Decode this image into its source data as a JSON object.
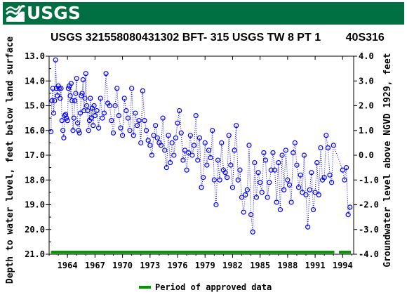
{
  "header": {
    "agency": "USGS"
  },
  "colors": {
    "banner": "#006f41",
    "series": "#0000ff",
    "approved": "#009900"
  },
  "chart_data": {
    "type": "scatter",
    "title": "USGS 321558080431302 BFT- 315 USGS TW 8 PT 1        40S316",
    "ylabel": "Depth to water level, feet below land surface",
    "y2label": "Groundwater level above NGVD 1929, feet",
    "x_ticks": [
      "1964",
      "1967",
      "1970",
      "1973",
      "1976",
      "1979",
      "1982",
      "1985",
      "1988",
      "1991",
      "1994"
    ],
    "y_ticks": [
      "13.0",
      "14.0",
      "15.0",
      "16.0",
      "17.0",
      "18.0",
      "19.0",
      "20.0",
      "21.0"
    ],
    "y2_ticks": [
      "4.0",
      "3.0",
      "2.0",
      "1.0",
      "0.0",
      "-1.0",
      "-2.0",
      "-3.0",
      "-4.0"
    ],
    "xlim": [
      1962.0,
      1995.2
    ],
    "ylim": [
      21.0,
      13.0
    ],
    "y2lim": [
      -4.0,
      4.0
    ],
    "y_inverted": true,
    "series": [
      {
        "style": "dotted line with open circle markers",
        "x": [
          1962.2,
          1962.3,
          1962.4,
          1962.5,
          1962.6,
          1962.7,
          1962.8,
          1962.9,
          1963.0,
          1963.1,
          1963.2,
          1963.3,
          1963.4,
          1963.5,
          1963.6,
          1963.7,
          1963.8,
          1963.9,
          1964.0,
          1964.1,
          1964.2,
          1964.3,
          1964.4,
          1964.5,
          1964.6,
          1964.7,
          1964.8,
          1964.9,
          1965.0,
          1965.1,
          1965.2,
          1965.3,
          1965.4,
          1965.5,
          1965.6,
          1965.7,
          1965.8,
          1965.9,
          1966.0,
          1966.1,
          1966.2,
          1966.3,
          1966.4,
          1966.5,
          1966.6,
          1966.7,
          1966.8,
          1966.9,
          1967.0,
          1967.2,
          1967.4,
          1967.6,
          1967.8,
          1968.0,
          1968.2,
          1968.4,
          1968.6,
          1968.8,
          1969.0,
          1969.2,
          1969.4,
          1969.6,
          1969.8,
          1970.0,
          1970.2,
          1970.4,
          1970.6,
          1970.8,
          1971.0,
          1971.2,
          1971.4,
          1971.6,
          1971.8,
          1972.0,
          1972.2,
          1972.4,
          1972.6,
          1972.8,
          1973.0,
          1973.2,
          1973.4,
          1973.6,
          1973.8,
          1974.0,
          1974.2,
          1974.4,
          1974.6,
          1974.8,
          1975.0,
          1975.2,
          1975.4,
          1975.6,
          1975.8,
          1976.0,
          1976.2,
          1976.4,
          1976.6,
          1976.8,
          1977.0,
          1977.2,
          1977.4,
          1977.6,
          1977.8,
          1978.0,
          1978.2,
          1978.4,
          1978.6,
          1978.8,
          1979.0,
          1979.2,
          1979.4,
          1979.6,
          1979.8,
          1980.0,
          1980.2,
          1980.4,
          1980.6,
          1980.8,
          1981.0,
          1981.2,
          1981.4,
          1981.6,
          1981.8,
          1982.0,
          1982.2,
          1982.4,
          1982.6,
          1982.8,
          1983.0,
          1983.2,
          1983.4,
          1983.6,
          1983.8,
          1984.0,
          1984.2,
          1984.4,
          1984.6,
          1984.8,
          1985.0,
          1985.2,
          1985.4,
          1985.6,
          1985.8,
          1986.0,
          1986.2,
          1986.4,
          1986.6,
          1986.8,
          1987.0,
          1987.2,
          1987.4,
          1987.6,
          1987.8,
          1988.0,
          1988.2,
          1988.4,
          1988.6,
          1988.8,
          1989.0,
          1989.2,
          1989.4,
          1989.6,
          1989.8,
          1990.0,
          1990.2,
          1990.4,
          1990.6,
          1990.8,
          1991.0,
          1991.2,
          1991.4,
          1991.6,
          1991.8,
          1992.0,
          1992.2,
          1992.4,
          1992.6,
          1992.8,
          1993.0,
          1994.0,
          1994.2,
          1994.4,
          1994.6,
          1994.8
        ],
        "y": [
          16.05,
          14.8,
          14.3,
          15.3,
          14.8,
          13.15,
          14.3,
          14.6,
          14.2,
          14.3,
          14.7,
          14.3,
          15.6,
          16.0,
          16.3,
          15.4,
          15.35,
          15.5,
          15.6,
          14.3,
          14.2,
          14.6,
          14.1,
          14.8,
          16.0,
          15.5,
          14.8,
          14.5,
          13.9,
          15.7,
          16.0,
          16.1,
          15.3,
          14.6,
          14.5,
          13.95,
          15.2,
          14.7,
          13.7,
          15.0,
          15.2,
          16.0,
          15.6,
          14.7,
          15.5,
          15.1,
          15.8,
          15.0,
          15.4,
          15.2,
          15.9,
          14.7,
          15.5,
          15.3,
          13.7,
          14.9,
          15.0,
          15.6,
          16.1,
          15.0,
          14.3,
          15.4,
          15.9,
          16.2,
          14.7,
          15.2,
          15.5,
          16.0,
          14.3,
          16.2,
          15.3,
          15.8,
          15.6,
          16.5,
          14.4,
          15.6,
          16.0,
          16.4,
          16.6,
          17.0,
          16.2,
          15.8,
          16.3,
          16.5,
          16.6,
          15.5,
          16.8,
          17.5,
          16.2,
          17.3,
          16.5,
          17.0,
          16.3,
          15.7,
          15.2,
          16.1,
          17.2,
          16.8,
          17.6,
          16.9,
          16.2,
          17.0,
          16.6,
          15.4,
          17.2,
          16.3,
          18.3,
          17.9,
          16.5,
          17.4,
          16.8,
          17.1,
          16.0,
          18.0,
          19.0,
          17.2,
          18.0,
          16.5,
          17.6,
          17.7,
          17.9,
          16.2,
          17.4,
          18.3,
          16.8,
          15.8,
          18.0,
          17.6,
          18.7,
          19.3,
          18.6,
          18.4,
          16.6,
          19.4,
          20.1,
          17.3,
          18.7,
          17.7,
          18.1,
          18.5,
          16.9,
          17.2,
          18.7,
          18.1,
          17.6,
          16.9,
          17.6,
          18.9,
          17.3,
          19.2,
          17.0,
          18.4,
          16.8,
          18.0,
          18.2,
          18.9,
          16.9,
          16.5,
          17.4,
          18.3,
          17.8,
          18.5,
          17.0,
          18.6,
          19.9,
          18.4,
          17.7,
          19.2,
          18.5,
          17.3,
          18.6,
          16.7,
          18.0,
          17.9,
          16.2,
          16.7,
          17.8,
          18.1,
          16.6,
          17.6,
          18.0,
          17.5,
          19.4,
          19.1
        ]
      }
    ],
    "approved_periods": [
      [
        1962.2,
        1993.1
      ],
      [
        1993.6,
        1994.9
      ]
    ],
    "legend": {
      "label": "Period of approved data",
      "placement": "bottom-center"
    }
  }
}
